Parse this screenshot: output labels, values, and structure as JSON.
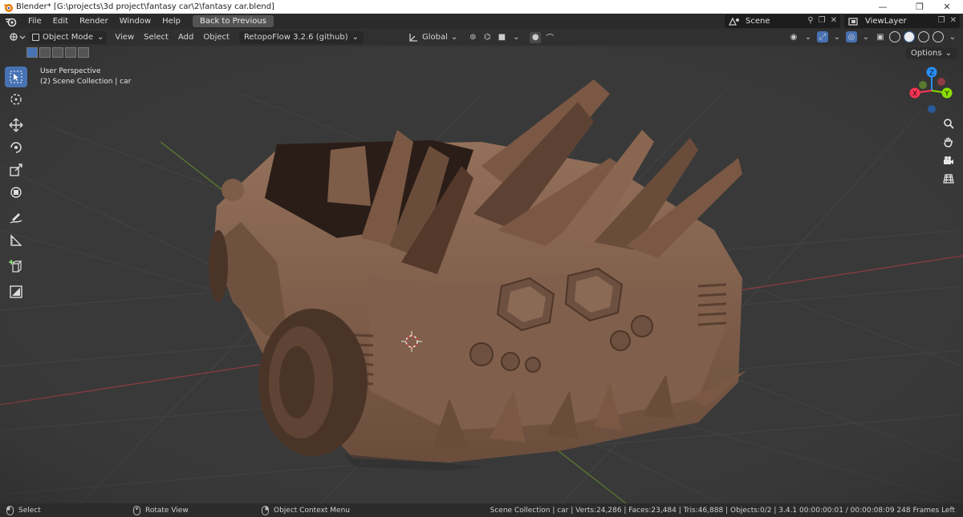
{
  "window": {
    "title": "Blender* [G:\\projects\\3d project\\fantasy car\\2\\fantasy car.blend]",
    "minimize_glyph": "—",
    "maximize_glyph": "❐",
    "close_glyph": "✕"
  },
  "topbar": {
    "menus": [
      "File",
      "Edit",
      "Render",
      "Window",
      "Help"
    ],
    "back_button": "Back to Previous",
    "scene": "Scene",
    "view_layer": "ViewLayer"
  },
  "viewport_header": {
    "mode": "Object Mode",
    "menus": [
      "View",
      "Select",
      "Add",
      "Object"
    ],
    "addon": "RetopoFlow 3.2.6 (github)",
    "transform_orientation": "Global",
    "options": "Options"
  },
  "viewport": {
    "perspective": "User Perspective",
    "collection": "(2) Scene Collection | car"
  },
  "gizmo": {
    "x_label": "X",
    "y_label": "Y",
    "z_label": "Z",
    "x_color": "#ff3352",
    "y_color": "#8bdc00",
    "z_color": "#2890ff"
  },
  "statusbar": {
    "select_hint": "Select",
    "rotate_hint": "Rotate View",
    "context_hint": "Object Context Menu",
    "stats": "Scene Collection | car | Verts:24,286 | Faces:23,484 | Tris:46,888 | Objects:0/2 | 3.4.1   00:00:00:01 / 00:00:08:09  248 Frames Left"
  },
  "colors": {
    "accent": "#4772b3",
    "viewport_bg": "#393939",
    "car_body": "#8a6650"
  }
}
